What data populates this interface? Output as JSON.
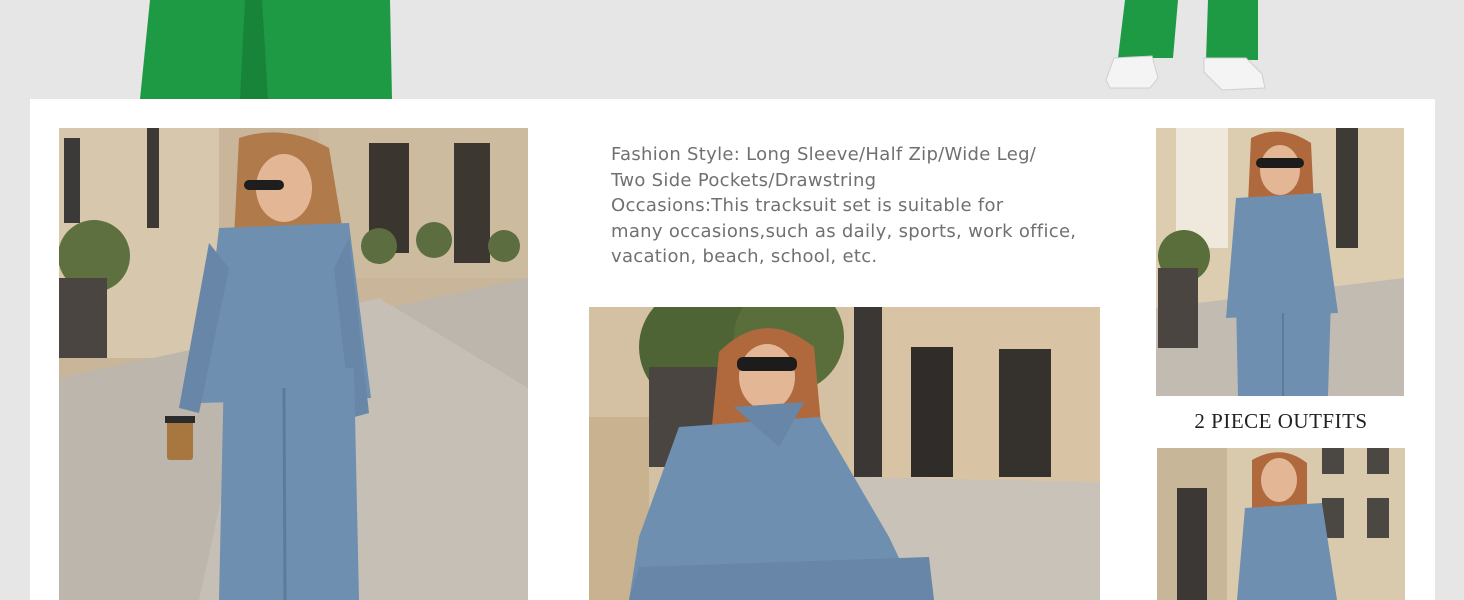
{
  "description": {
    "lines": [
      "Fashion Style: Long Sleeve/Half Zip/Wide Leg/",
      "Two Side Pockets/Drawstring",
      "Occasions:This tracksuit set is suitable for",
      "many occasions,such as daily, sports, work office,",
      "vacation, beach, school, etc."
    ]
  },
  "caption": "2 PIECE OUTFITS",
  "colors": {
    "background": "#e6e6e6",
    "panel": "#ffffff",
    "outfit_blue": "#6e8fb0",
    "outfit_green": "#1e9a45",
    "text": "#707070"
  }
}
